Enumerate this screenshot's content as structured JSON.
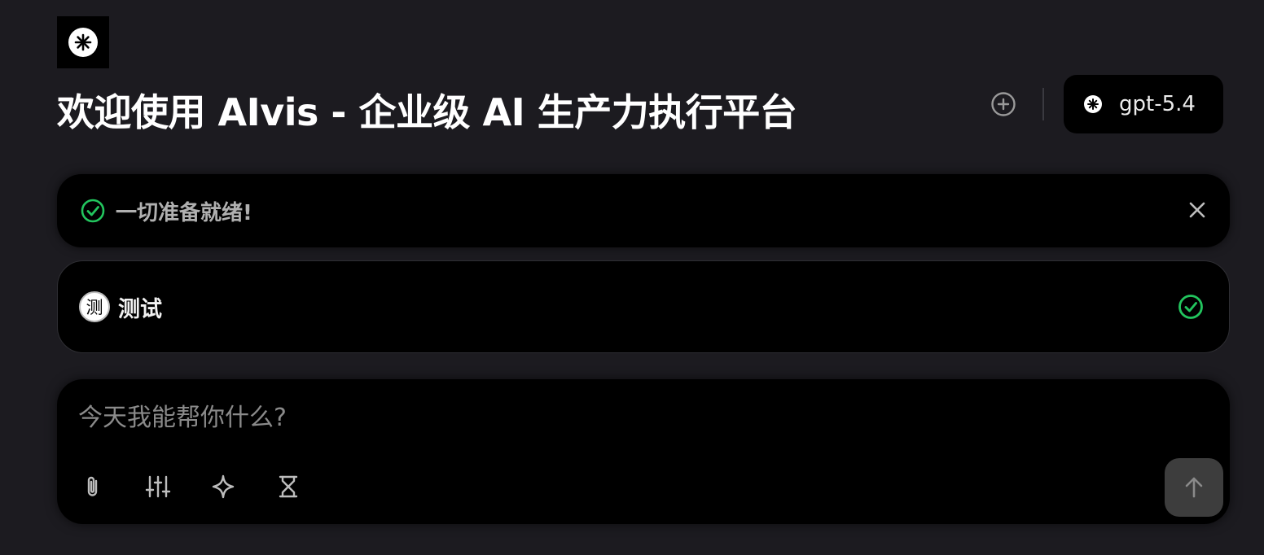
{
  "header": {
    "logo_icon": "asterisk-logo-icon",
    "title": "欢迎使用 AIvis - 企业级 AI 生产力执行平台",
    "new_chat_icon": "plus-circle-icon",
    "model": {
      "icon": "openai-logo-icon",
      "name": "gpt-5.4"
    }
  },
  "status_bar": {
    "icon": "check-circle-icon",
    "message": "一切准备就绪!",
    "close_icon": "close-icon",
    "status_color": "#22c55e"
  },
  "agent": {
    "avatar_text": "测",
    "name": "测试",
    "status_icon": "check-circle-icon"
  },
  "composer": {
    "placeholder": "今天我能帮你什么?",
    "value": "",
    "tools": [
      "paperclip-icon",
      "sliders-icon",
      "sparkle-icon",
      "hourglass-icon"
    ],
    "send_icon": "arrow-up-icon"
  }
}
